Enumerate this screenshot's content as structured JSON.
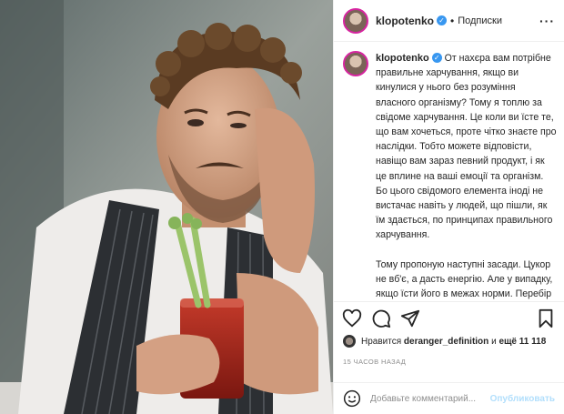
{
  "post": {
    "username": "klopotenko",
    "follow_label": "Подписки",
    "caption_paragraphs": [
      "От нахєра вам потрібне правильне харчування, якщо ви кинулися у нього без розуміння власного організму? Тому я топлю за свідоме харчування. Це коли ви їсте те, що вам хочеться, проте чітко знаєте про наслідки. Тобто можете відповісти, навіщо вам зараз певний продукт, і як це вплине на ваші емоції та організм. Бо цього свідомого елемента іноді не вистачає навіть у людей, що пішли, як їм здається, по принципах правильного харчування.",
      "Тому пропоную наступні засади. Цукор не вб'є, а дасть енергію. Але у випадку, якщо їсти його в межах норми. Перебір нікому не потрібен. Звісно, ви від переїдання цукру не"
    ],
    "likes_prefix": "Нравится",
    "likes_user": "deranger_definition",
    "likes_middle": "и",
    "likes_count": "ещё 11 118",
    "timestamp": "15 ЧАСОВ НАЗАД",
    "comment_placeholder": "Добавьте комментарий...",
    "publish_label": "Опубликовать"
  },
  "icons": {
    "like": "heart-icon",
    "comment": "comment-icon",
    "share": "share-icon",
    "save": "bookmark-icon",
    "more": "more-options-icon",
    "emoji": "emoji-icon",
    "verified": "verified-badge-icon"
  },
  "colors": {
    "verified": "#3897f0",
    "publish_disabled": "#b2dffc",
    "muted": "#8e8e8e"
  }
}
